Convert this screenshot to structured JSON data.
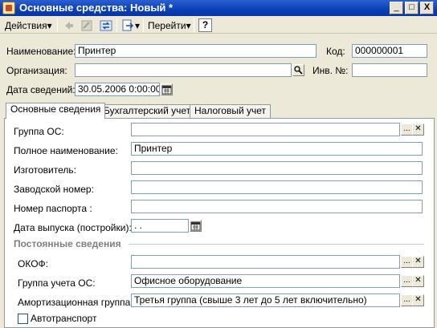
{
  "window": {
    "title": "Основные средства: Новый *",
    "controls": {
      "minimize": "_",
      "maximize": "□",
      "close": "X"
    }
  },
  "toolbar": {
    "actions_label": "Действия",
    "goto_label": "Перейти",
    "help_label": "?"
  },
  "header": {
    "name_label": "Наименование:",
    "name_value": "Принтер",
    "code_label": "Код:",
    "code_value": "000000001",
    "org_label": "Организация:",
    "org_value": "",
    "inv_label": "Инв. №:",
    "inv_value": "",
    "date_label": "Дата сведений:",
    "date_value": "30.05.2006  0:00:00"
  },
  "tabs": [
    {
      "label": "Основные сведения",
      "active": true
    },
    {
      "label": "Бухгалтерский учет",
      "active": false
    },
    {
      "label": "Налоговый учет",
      "active": false
    }
  ],
  "main": {
    "group_os_label": "Группа ОС:",
    "group_os_value": "",
    "full_name_label": "Полное наименование:",
    "full_name_value": "Принтер",
    "maker_label": "Изготовитель:",
    "maker_value": "",
    "serial_label": "Заводской номер:",
    "serial_value": "",
    "passport_label": "Номер паспорта :",
    "passport_value": "",
    "release_label": "Дата выпуска (постройки):",
    "release_value": "  .  .",
    "section_title": "Постоянные сведения",
    "okof_label": "ОКОФ:",
    "okof_value": "",
    "group_acc_label": "Группа учета ОС:",
    "group_acc_value": "Офисное оборудование",
    "amort_label": "Амортизационная группа:",
    "amort_value": "Третья группа (свыше 3 лет до 5 лет включительно)",
    "auto_label": "Автотранспорт"
  },
  "icons": {
    "ellipsis": "...",
    "clear": "✕",
    "dropdown": "▾"
  }
}
